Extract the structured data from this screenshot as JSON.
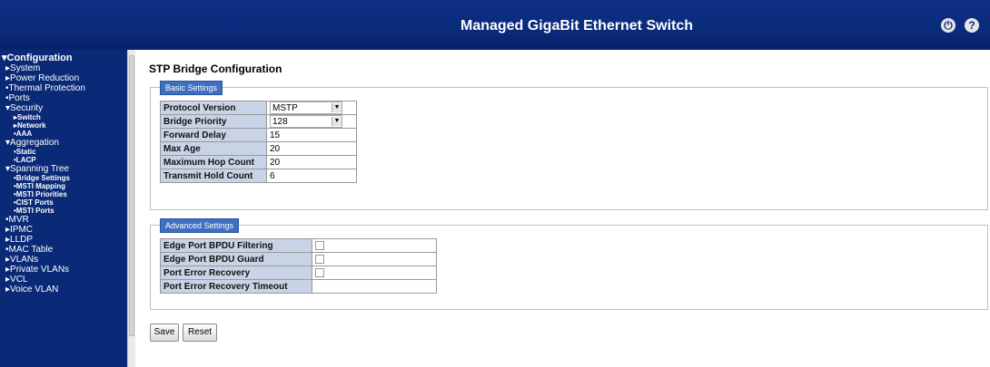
{
  "header": {
    "title": "Managed GigaBit Ethernet Switch"
  },
  "sidebar": {
    "items": [
      {
        "label": "▾Configuration",
        "level": "top"
      },
      {
        "label": "▸System",
        "level": "l1"
      },
      {
        "label": "▸Power Reduction",
        "level": "l1"
      },
      {
        "label": "•Thermal Protection",
        "level": "l1"
      },
      {
        "label": "•Ports",
        "level": "l1"
      },
      {
        "label": "▾Security",
        "level": "l1"
      },
      {
        "label": "▸Switch",
        "level": "l2"
      },
      {
        "label": "▸Network",
        "level": "l2"
      },
      {
        "label": "•AAA",
        "level": "l2"
      },
      {
        "label": "▾Aggregation",
        "level": "l1"
      },
      {
        "label": "•Static",
        "level": "l2"
      },
      {
        "label": "•LACP",
        "level": "l2"
      },
      {
        "label": "▾Spanning Tree",
        "level": "l1"
      },
      {
        "label": "•Bridge Settings",
        "level": "l2"
      },
      {
        "label": "•MSTI Mapping",
        "level": "l2"
      },
      {
        "label": "•MSTI Priorities",
        "level": "l2"
      },
      {
        "label": "•CIST Ports",
        "level": "l2"
      },
      {
        "label": "•MSTI Ports",
        "level": "l2"
      },
      {
        "label": "•MVR",
        "level": "l1"
      },
      {
        "label": "▸IPMC",
        "level": "l1"
      },
      {
        "label": "▸LLDP",
        "level": "l1"
      },
      {
        "label": "•MAC Table",
        "level": "l1"
      },
      {
        "label": "▸VLANs",
        "level": "l1"
      },
      {
        "label": "▸Private VLANs",
        "level": "l1"
      },
      {
        "label": "▸VCL",
        "level": "l1"
      },
      {
        "label": "▸Voice VLAN",
        "level": "l1"
      }
    ]
  },
  "main": {
    "page_title": "STP Bridge Configuration",
    "basic": {
      "legend": "Basic Settings",
      "protocol_version": {
        "label": "Protocol Version",
        "value": "MSTP"
      },
      "bridge_priority": {
        "label": "Bridge Priority",
        "value": "128"
      },
      "forward_delay": {
        "label": "Forward Delay",
        "value": "15"
      },
      "max_age": {
        "label": "Max Age",
        "value": "20"
      },
      "max_hop_count": {
        "label": "Maximum Hop Count",
        "value": "20"
      },
      "transmit_hold_count": {
        "label": "Transmit Hold Count",
        "value": "6"
      }
    },
    "advanced": {
      "legend": "Advanced Settings",
      "edge_bpdu_filtering": {
        "label": "Edge Port BPDU Filtering",
        "checked": false
      },
      "edge_bpdu_guard": {
        "label": "Edge Port BPDU Guard",
        "checked": false
      },
      "port_error_recovery": {
        "label": "Port Error Recovery",
        "checked": false
      },
      "port_error_recovery_timeout": {
        "label": "Port Error Recovery Timeout",
        "value": ""
      }
    },
    "buttons": {
      "save": "Save",
      "reset": "Reset"
    }
  },
  "colors": {
    "header_bg": "#0a2a7a",
    "sidebar_bg": "#0a2a78",
    "label_bg": "#c9d3e6",
    "legend_bg": "#3f6fbf"
  },
  "icons": {
    "logout": "logout-icon",
    "help": "help-icon"
  }
}
